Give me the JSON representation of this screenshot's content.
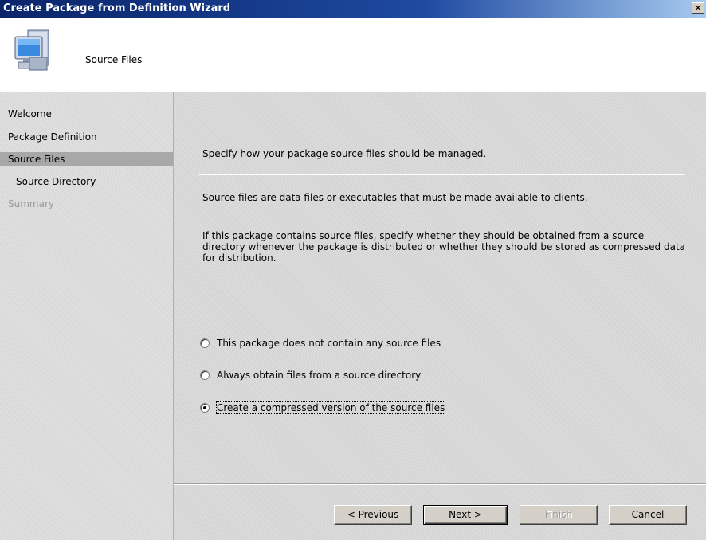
{
  "window": {
    "title": "Create Package from Definition Wizard",
    "close_glyph": "✕"
  },
  "header": {
    "title": "Source Files",
    "icon": "computer-icon"
  },
  "nav": {
    "items": [
      {
        "label": "Welcome"
      },
      {
        "label": "Package Definition"
      },
      {
        "label": "Source Files"
      },
      {
        "label": "Source Directory"
      },
      {
        "label": "Summary"
      }
    ]
  },
  "content": {
    "intro": "Specify how your package source files should be managed.",
    "description1": "Source files are data files or executables that must be made available to clients.",
    "description2": "If this package contains source files, specify whether they should be obtained from a source directory whenever the package is distributed or whether they should be stored as compressed data for distribution.",
    "options": [
      {
        "label": "This package does not contain any source files",
        "selected": false
      },
      {
        "label": "Always obtain files from a source directory",
        "selected": false
      },
      {
        "label": "Create a compressed version of the source files",
        "selected": true
      }
    ]
  },
  "buttons": {
    "previous": "< Previous",
    "next": "Next >",
    "finish": "Finish",
    "cancel": "Cancel"
  }
}
